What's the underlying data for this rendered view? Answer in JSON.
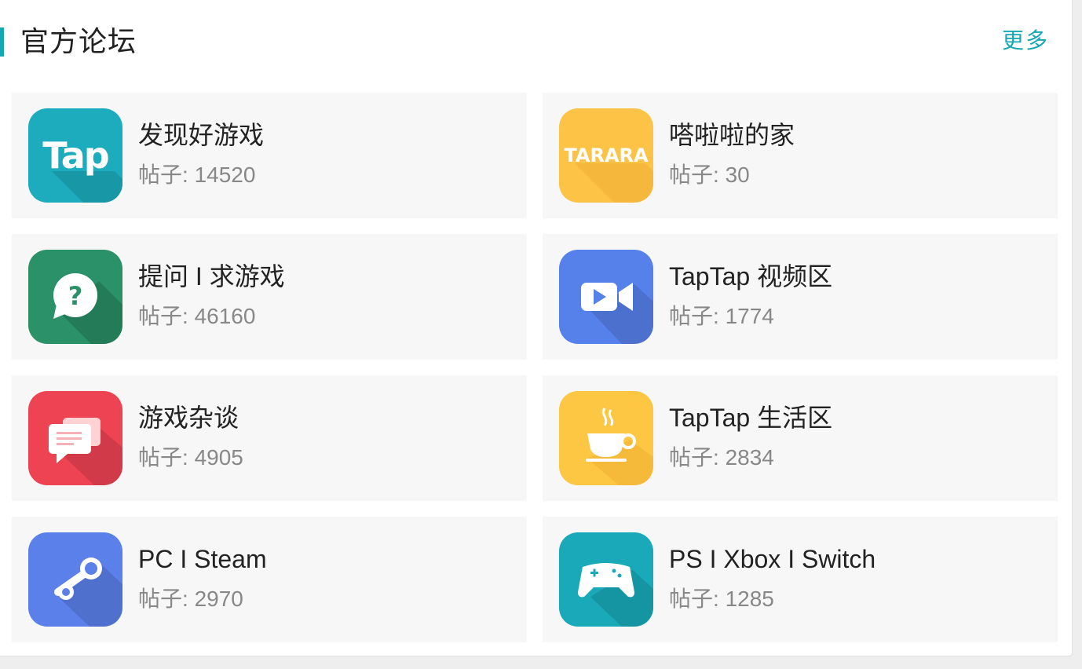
{
  "section": {
    "title": "官方论坛",
    "more_label": "更多"
  },
  "posts_prefix": "帖子: ",
  "forums": [
    {
      "name": "发现好游戏",
      "posts": "14520",
      "icon": "tap-logo-icon",
      "color": "#1cacbd"
    },
    {
      "name": "嗒啦啦的家",
      "posts": "30",
      "icon": "tarara-logo-icon",
      "color": "#fcc347",
      "icon_text": "TARARA"
    },
    {
      "name": "提问 I 求游戏",
      "posts": "46160",
      "icon": "question-bubble-icon",
      "color": "#2b9168"
    },
    {
      "name": "TapTap 视频区",
      "posts": "1774",
      "icon": "video-camera-icon",
      "color": "#5680ea"
    },
    {
      "name": "游戏杂谈",
      "posts": "4905",
      "icon": "chat-bubbles-icon",
      "color": "#ee4352"
    },
    {
      "name": "TapTap 生活区",
      "posts": "2834",
      "icon": "coffee-cup-icon",
      "color": "#fdc643"
    },
    {
      "name": "PC I Steam",
      "posts": "2970",
      "icon": "steam-logo-icon",
      "color": "#5c80ea"
    },
    {
      "name": "PS I Xbox I Switch",
      "posts": "1285",
      "icon": "gamepad-icon",
      "color": "#19a9b8"
    }
  ]
}
